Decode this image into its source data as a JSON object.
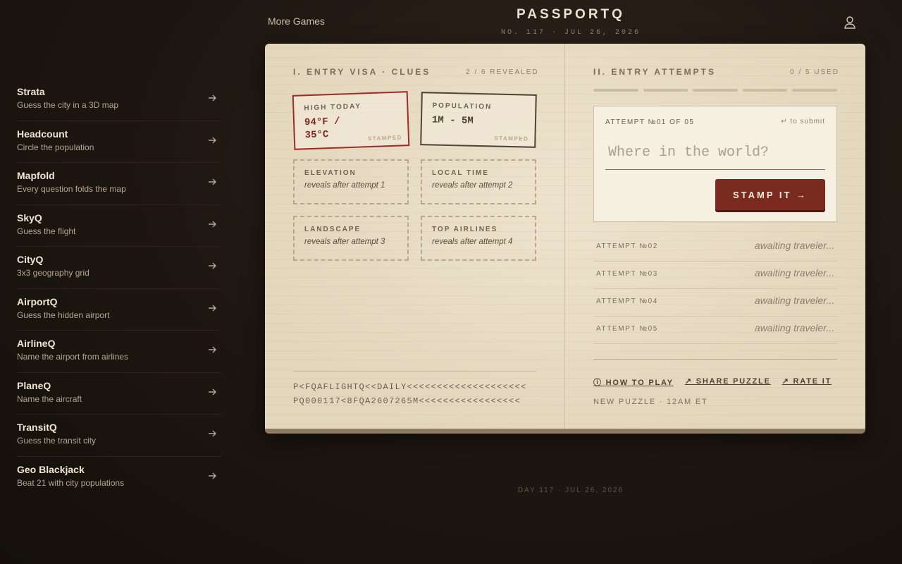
{
  "header": {
    "more_games": "More Games",
    "brand": "PASSPORTQ",
    "edition": "NO. 117 · JUL 26, 2026"
  },
  "sidebar": {
    "items": [
      {
        "name": "Strata",
        "desc": "Guess the city in a 3D map"
      },
      {
        "name": "Headcount",
        "desc": "Circle the population"
      },
      {
        "name": "Mapfold",
        "desc": "Every question folds the map"
      },
      {
        "name": "SkyQ",
        "desc": "Guess the flight"
      },
      {
        "name": "CityQ",
        "desc": "3x3 geography grid"
      },
      {
        "name": "AirportQ",
        "desc": "Guess the hidden airport"
      },
      {
        "name": "AirlineQ",
        "desc": "Name the airport from airlines"
      },
      {
        "name": "PlaneQ",
        "desc": "Name the aircraft"
      },
      {
        "name": "TransitQ",
        "desc": "Guess the transit city"
      },
      {
        "name": "Geo Blackjack",
        "desc": "Beat 21 with city populations"
      }
    ]
  },
  "visa": {
    "title": "I. ENTRY VISA · CLUES",
    "revealed": "2 / 6 REVEALED",
    "stamped_clues": [
      {
        "label": "HIGH TODAY",
        "value_line1": "94°F /",
        "value_line2": "35°C",
        "tag": "STAMPED"
      },
      {
        "label": "POPULATION",
        "value_line1": "1M - 5M",
        "value_line2": "",
        "tag": "STAMPED"
      }
    ],
    "pending_clues": [
      {
        "label": "ELEVATION",
        "note": "reveals after attempt 1"
      },
      {
        "label": "LOCAL TIME",
        "note": "reveals after attempt 2"
      },
      {
        "label": "LANDSCAPE",
        "note": "reveals after attempt 3"
      },
      {
        "label": "TOP AIRLINES",
        "note": "reveals after attempt 4"
      }
    ],
    "mrz_line1": "P<FQAFLIGHTQ<<DAILY<<<<<<<<<<<<<<<<<<<<",
    "mrz_line2": "PQ000117<8FQA2607265M<<<<<<<<<<<<<<<<<"
  },
  "attempts": {
    "title": "II. ENTRY ATTEMPTS",
    "used": "0 / 5 USED",
    "current_label": "ATTEMPT №01 OF 05",
    "submit_hint": "↵ to submit",
    "input_placeholder": "Where in the world?",
    "input_value": "",
    "stamp_button": "STAMP IT →",
    "rows": [
      {
        "label": "ATTEMPT №02",
        "status": "awaiting traveler..."
      },
      {
        "label": "ATTEMPT №03",
        "status": "awaiting traveler..."
      },
      {
        "label": "ATTEMPT №04",
        "status": "awaiting traveler..."
      },
      {
        "label": "ATTEMPT №05",
        "status": "awaiting traveler..."
      }
    ],
    "links": {
      "how_to_play": "ⓘ HOW TO PLAY",
      "share": "↗ SHARE PUZZLE",
      "rate": "↗ RATE IT"
    },
    "new_puzzle": "NEW PUZZLE · 12AM ET"
  },
  "footer": {
    "day": "DAY 117 · JUL 26, 2026"
  },
  "colors": {
    "background": "#1e1711",
    "paper": "#e7dcc4",
    "stamp_red": "#9d2d26",
    "button": "#7a2a1f",
    "ink": "#4c4030"
  },
  "icons": {
    "sidebar_arrow": "arrow-right-icon",
    "account": "user-icon"
  }
}
